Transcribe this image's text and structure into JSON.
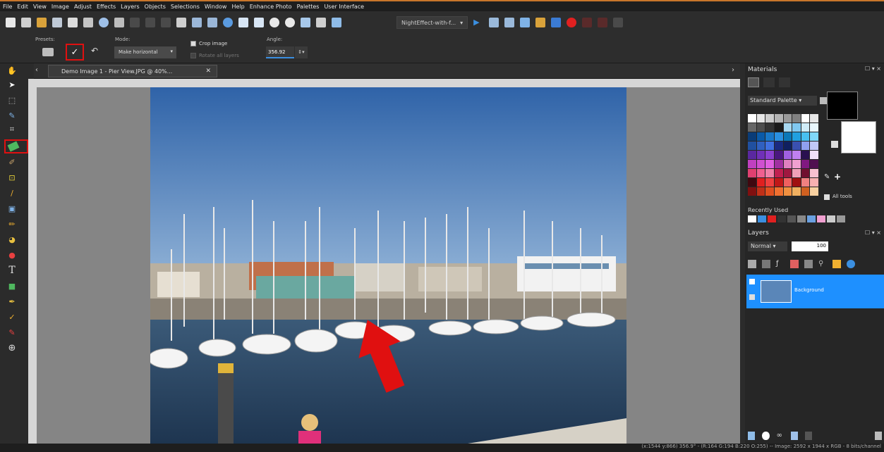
{
  "menu": [
    "File",
    "Edit",
    "View",
    "Image",
    "Adjust",
    "Effects",
    "Layers",
    "Objects",
    "Selections",
    "Window",
    "Help",
    "Enhance Photo",
    "Palettes",
    "User Interface"
  ],
  "toolbar": {
    "script_select": "NightEffect-with-f..."
  },
  "options": {
    "presets_label": "Presets:",
    "mode_label": "Mode:",
    "mode_value": "Make horizontal",
    "crop_label": "Crop image",
    "rotate_label": "Rotate all layers",
    "angle_label": "Angle:",
    "angle_value": "356.92"
  },
  "document": {
    "tab_title": "Demo Image 1 - Pier View.JPG @  40%..."
  },
  "materials": {
    "title": "Materials",
    "palette": "Standard Palette",
    "all_tools": "All tools",
    "recently_used": "Recently Used"
  },
  "layers": {
    "title": "Layers",
    "blend_mode": "Normal",
    "opacity": "100",
    "layer_name": "Background"
  },
  "status": {
    "text": "(x:1544 y:866) 356.9° - (R:164 G:194 B:220 O:255) -- Image: 2592 x 1944 x RGB - 8 bits/channel"
  },
  "colors": {
    "accent": "#1e90ff",
    "highlight_red": "#e01010",
    "sky": "#3d6fae",
    "water": "#2c4a68"
  }
}
